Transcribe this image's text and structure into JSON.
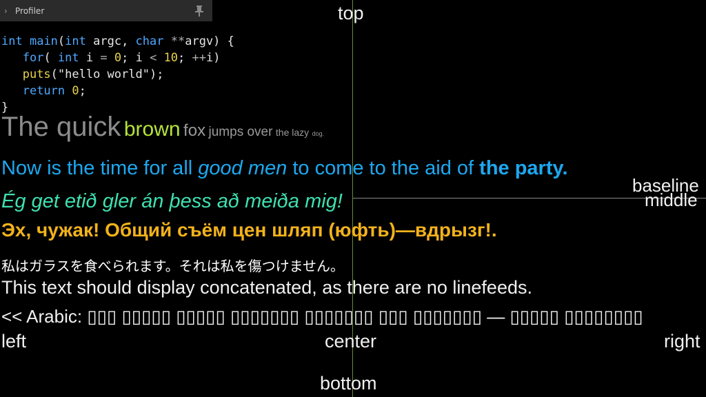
{
  "profiler": {
    "title": "Profiler",
    "chevron": "chevron-right-icon",
    "pin": "pin-icon",
    "background": "#2b2b2b"
  },
  "code": {
    "line1": {
      "a": "int",
      "b": " ",
      "c": "main",
      "d": "(",
      "e": "int",
      "f": " argc, ",
      "g": "char",
      "h": " ",
      "i": "**",
      "j": "argv) {"
    },
    "line2": {
      "indent": "   ",
      "a": "for",
      "b": "( ",
      "c": "int",
      "d": " i ",
      "e": "=",
      "f": " ",
      "g": "0",
      "h": "; i ",
      "i": "<",
      "j": " ",
      "k": "10",
      "l": "; ",
      "m": "++",
      "n": "i)"
    },
    "line3": {
      "indent": "   ",
      "a": "puts",
      "b": "(\"hello world\");"
    },
    "line4": {
      "indent": "   ",
      "a": "return",
      "b": " ",
      "c": "0",
      "d": ";"
    },
    "line5": {
      "a": "}"
    }
  },
  "quick": {
    "w1": "The quick",
    "w2": "brown",
    "w3": "fox",
    "w4": "jumps over",
    "w5": "the lazy",
    "w6": "dog."
  },
  "now": {
    "p1": "Now is the time for all ",
    "p2": "good men",
    "p3": " to come to the aid of ",
    "p4": "the party."
  },
  "icelandic": "Ég get etið gler án þess að meiða mig!",
  "russian": "Эх, чужак! Общий съём цен шляп (юфть)—вдрызг!.",
  "japanese": "私はガラスを食べられます。それは私を傷つけません。",
  "concat": "This text should display concatenated, as there are no linefeeds.",
  "arabic": {
    "prefix": "<< Arabic: ",
    "glyphs": "▯▯▯ ▯▯▯▯▯ ▯▯▯▯▯ ▯▯▯▯▯▯▯ ▯▯▯▯▯▯▯ ▯▯▯ ▯▯▯▯▯▯▯ — ▯▯▯▯▯ ▯▯▯▯▯▯▯▯"
  },
  "labels": {
    "top": "top",
    "left": "left",
    "center": "center",
    "right": "right",
    "bottom": "bottom",
    "baseline": "baseline",
    "middle": "middle"
  },
  "colors": {
    "code_keyword": "#4fa8ff",
    "code_function": "#e8d34a",
    "quick_gray": "#8c8c8c",
    "brown_green": "#b6e43a",
    "now_blue": "#1da8f0",
    "icelandic_teal": "#3fe0b0",
    "russian_orange": "#f2b21b",
    "guide_vertical": "#6a8a3a",
    "guide_horizontal": "#8a8a8a"
  }
}
